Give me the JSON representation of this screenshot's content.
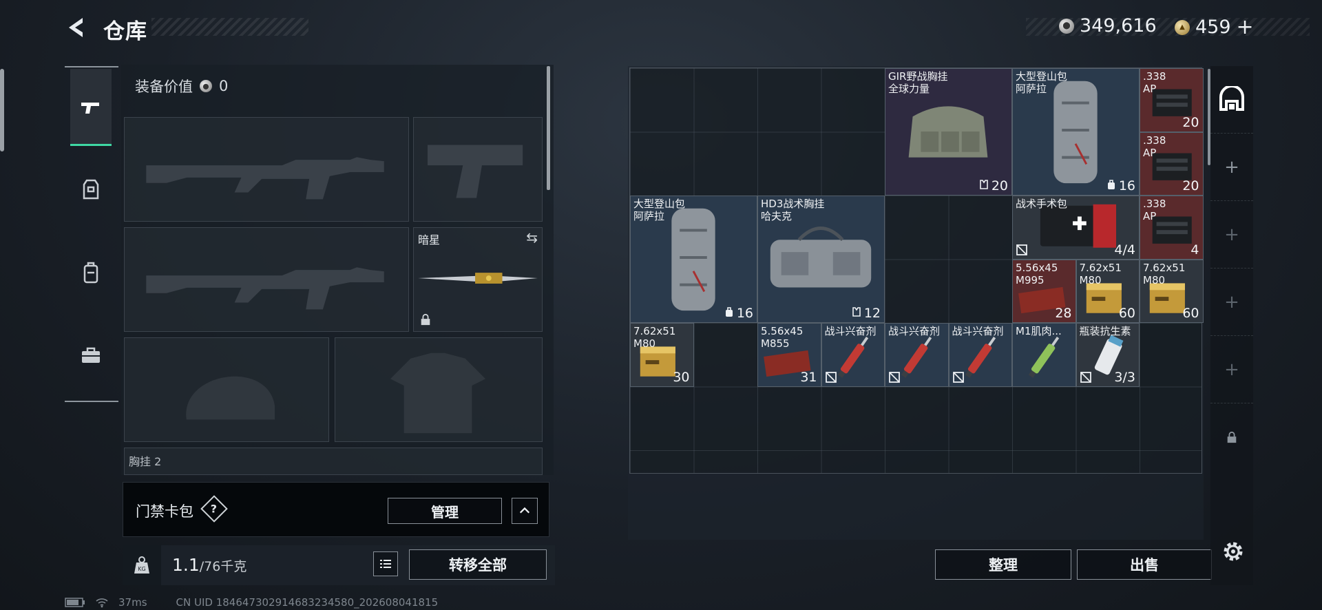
{
  "header": {
    "title": "仓库",
    "silver_amount": "349,616",
    "gold_amount": "459",
    "gold_add": "+"
  },
  "left_tabs": [
    "pistol",
    "vest",
    "backpack",
    "toolbox"
  ],
  "loadout": {
    "equip_value_label": "装备价值",
    "equip_value": "0",
    "melee_label": "暗星",
    "bottom_label_partial": "胸挂 2"
  },
  "card_pack": {
    "label": "门禁卡包",
    "help": "?",
    "manage": "管理"
  },
  "weight": {
    "current": "1.1",
    "capacity": "/76千克",
    "transfer_all": "转移全部"
  },
  "stash_items": [
    {
      "name": "GIR野战胸挂\n全球力量",
      "qty": "20",
      "qty_icon": "vest",
      "bg": "purple"
    },
    {
      "name": "大型登山包\n阿萨拉",
      "qty": "16",
      "qty_icon": "bag",
      "bg": "blue"
    },
    {
      "name": ".338\nAP",
      "qty": "20",
      "bg": "red"
    },
    {
      "name": ".338\nAP",
      "qty": "20",
      "bg": "red"
    },
    {
      "name": "大型登山包\n阿萨拉",
      "qty": "16",
      "qty_icon": "bag",
      "bg": "blue"
    },
    {
      "name": "HD3战术胸挂\n哈夫克",
      "qty": "12",
      "qty_icon": "vest",
      "bg": "blue"
    },
    {
      "name": "战术手术包",
      "qty": "4/4",
      "no_insure": true,
      "bg": "gray"
    },
    {
      "name": ".338\nAP",
      "qty": "4",
      "bg": "red"
    },
    {
      "name": "5.56x45\nM995",
      "qty": "28",
      "bg": "red"
    },
    {
      "name": "7.62x51\nM80",
      "qty": "60",
      "bg": "gray"
    },
    {
      "name": "7.62x51\nM80",
      "qty": "60",
      "bg": "gray"
    },
    {
      "name": "7.62x51\nM80",
      "qty": "30",
      "bg": "gray"
    },
    {
      "name": "5.56x45\nM855",
      "qty": "31",
      "bg": "blue"
    },
    {
      "name": "战斗兴奋剂",
      "qty": "",
      "no_insure": true,
      "bg": "blue"
    },
    {
      "name": "战斗兴奋剂",
      "qty": "",
      "no_insure": true,
      "bg": "blue"
    },
    {
      "name": "战斗兴奋剂",
      "qty": "",
      "no_insure": true,
      "bg": "blue"
    },
    {
      "name": "M1肌肉...",
      "qty": "",
      "bg": "blue"
    },
    {
      "name": "瓶装抗生素",
      "qty": "3/3",
      "no_insure": true,
      "bg": "gray"
    }
  ],
  "stash_buttons": {
    "organize": "整理",
    "sell": "出售"
  },
  "status_bar": {
    "ping": "37ms",
    "uid": "CN UID 1846473029146832345​80_202608041815"
  }
}
